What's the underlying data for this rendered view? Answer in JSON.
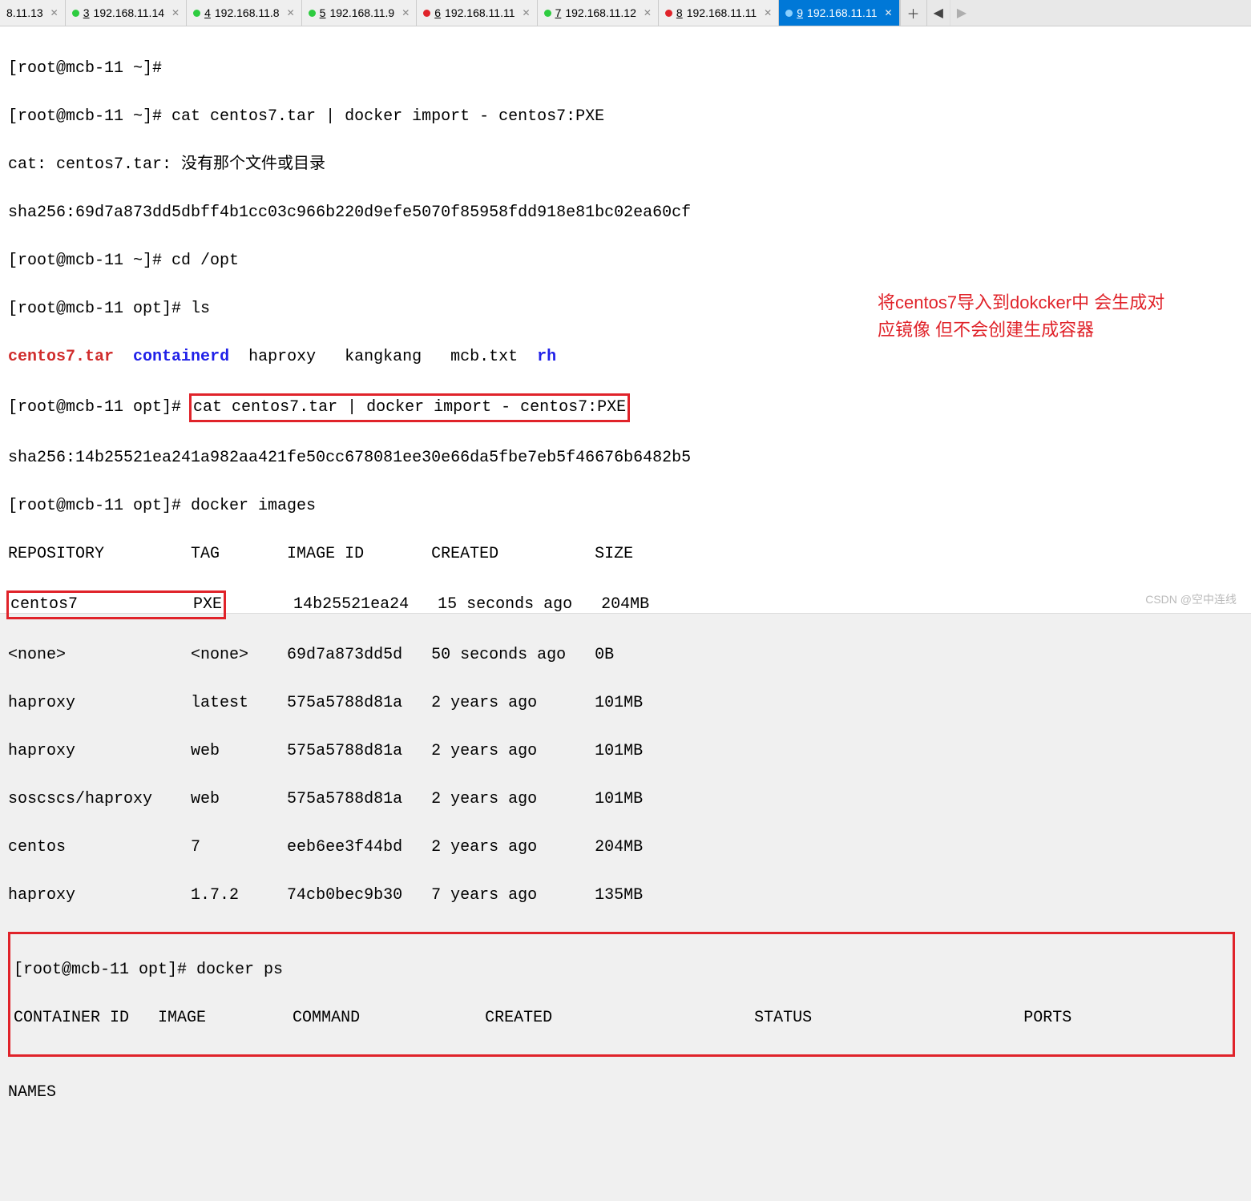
{
  "tabs": {
    "partial": {
      "label": "8.11.13"
    },
    "t3": {
      "num": "3",
      "ip": "192.168.11.14",
      "dot": "green"
    },
    "t4": {
      "num": "4",
      "ip": "192.168.11.8",
      "dot": "green"
    },
    "t5": {
      "num": "5",
      "ip": "192.168.11.9",
      "dot": "green"
    },
    "t6": {
      "num": "6",
      "ip": "192.168.11.11",
      "dot": "red"
    },
    "t7": {
      "num": "7",
      "ip": "192.168.11.12",
      "dot": "green"
    },
    "t8": {
      "num": "8",
      "ip": "192.168.11.11",
      "dot": "red"
    },
    "t9": {
      "num": "9",
      "ip": "192.168.11.11",
      "dot": "blue"
    }
  },
  "term": {
    "l1": "[root@mcb-11 ~]#",
    "l2a": "[root@mcb-11 ~]# cat centos7.tar | docker import - centos7:PXE",
    "l3": "cat: centos7.tar: 没有那个文件或目录",
    "l4": "sha256:69d7a873dd5dbff4b1cc03c966b220d9efe5070f85958fdd918e81bc02ea60cf",
    "l5": "[root@mcb-11 ~]# cd /opt",
    "l6": "[root@mcb-11 opt]# ls",
    "ls_red": "centos7.tar",
    "ls_blue1": "containerd",
    "ls_plain": "  haproxy   kangkang   mcb.txt  ",
    "ls_blue2": "rh",
    "l8a": "[root@mcb-11 opt]# ",
    "l8b": "cat centos7.tar | docker import - centos7:PXE",
    "l9": "sha256:14b25521ea241a982aa421fe50cc678081ee30e66da5fbe7eb5f46676b6482b5",
    "l10": "[root@mcb-11 opt]# docker images",
    "hdr": "REPOSITORY         TAG       IMAGE ID       CREATED          SIZE",
    "row1a": "centos7            PXE",
    "row1b": "       14b25521ea24   15 seconds ago   204MB",
    "row2": "<none>             <none>    69d7a873dd5d   50 seconds ago   0B",
    "row3": "haproxy            latest    575a5788d81a   2 years ago      101MB",
    "row4": "haproxy            web       575a5788d81a   2 years ago      101MB",
    "row5": "soscscs/haproxy    web       575a5788d81a   2 years ago      101MB",
    "row6": "centos             7         eeb6ee3f44bd   2 years ago      204MB",
    "row7": "haproxy            1.7.2     74cb0bec9b30   7 years ago      135MB",
    "ps1": "[root@mcb-11 opt]# docker ps",
    "ps2": "CONTAINER ID   IMAGE     COMMAND   CREATED   STATUS    PORTS     ",
    "psN1": "CONTAINER ID   IMAGE         COMMAND             CREATED                     STATUS                      PORTS",
    "names": "NAMES"
  },
  "annotation": "将centos7导入到dokcker中 会生成对应镜像 但不会创建生成容器",
  "watermark": "CSDN @空中连线"
}
